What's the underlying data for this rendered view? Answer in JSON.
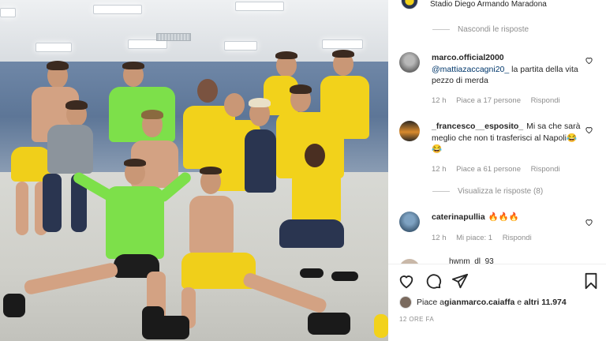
{
  "post": {
    "location": "Stadio Diego Armando Maradona",
    "hide_replies": "Nascondi le risposte",
    "view_replies": "Visualizza le risposte (8)",
    "likes_prefix": "Piace a ",
    "likes_user": "gianmarco.caiaffa",
    "likes_mid": " e ",
    "likes_others": "altri 11.974",
    "time_ago": "12 ORE FA"
  },
  "comments": [
    {
      "user": "marco.official2000",
      "mention": "@mattiazaccagni20_",
      "text": " la partita della vita pezzo di merda",
      "time": "12 h",
      "likes": "Piace a 17 persone",
      "reply": "Rispondi"
    },
    {
      "user": "_francesco__esposito_",
      "mention": "",
      "text": "Mi sa che sarà meglio che non ti trasferisci al Napoli😂😂",
      "time": "12 h",
      "likes": "Piace a 61 persone",
      "reply": "Rispondi"
    },
    {
      "user": "caterinapullia",
      "mention": "",
      "text": "🔥🔥🔥",
      "time": "12 h",
      "likes": "Mi piace: 1",
      "reply": "Rispondi"
    }
  ],
  "partial_comment": "hwnm_dl_93 ",
  "icons": {
    "like": "heart-icon",
    "comment": "comment-icon",
    "share": "share-icon",
    "save": "bookmark-icon",
    "comment_like": "heart-icon"
  },
  "colors": {
    "mention": "#00376b",
    "muted": "#8e8e8e",
    "text": "#262626"
  }
}
